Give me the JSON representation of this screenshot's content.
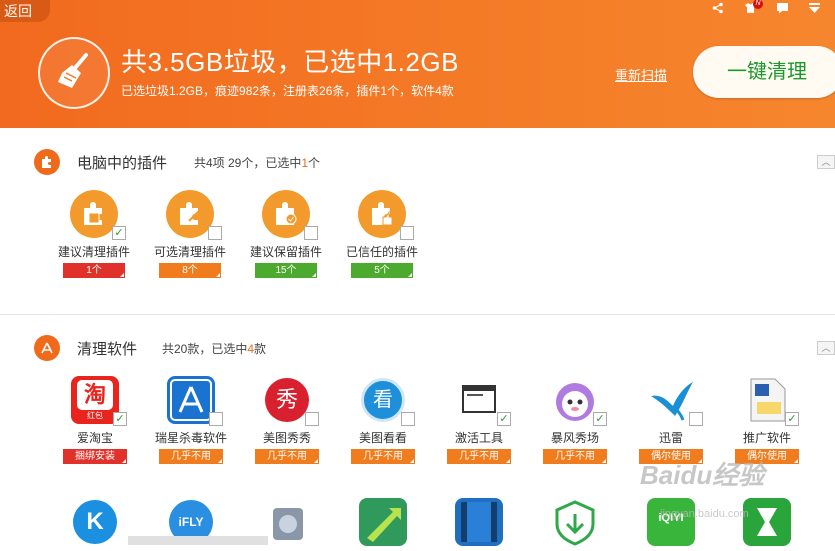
{
  "header": {
    "back": "返回",
    "title": "共3.5GB垃圾，已选中1.2GB",
    "subtitle": "已选垃圾1.2GB，痕迹982条，注册表26条，插件1个，软件4款",
    "rescan": "重新扫描",
    "clean_button": "一键清理",
    "badge": "N"
  },
  "plugins_section": {
    "title": "电脑中的插件",
    "count_prefix": "共4项 29个，已选中",
    "count_highlight": "1",
    "count_suffix": "个",
    "items": [
      {
        "label": "建议清理插件",
        "tag": "1个",
        "checked": true
      },
      {
        "label": "可选清理插件",
        "tag": "8个",
        "checked": false
      },
      {
        "label": "建议保留插件",
        "tag": "15个",
        "checked": false
      },
      {
        "label": "已信任的插件",
        "tag": "5个",
        "checked": false
      }
    ]
  },
  "software_section": {
    "title": "清理软件",
    "count_prefix": "共20款，已选中",
    "count_highlight": "4",
    "count_suffix": "款",
    "apps": [
      {
        "label": "爱淘宝",
        "tag": "捆绑安装",
        "glyph": "淘",
        "sub": "红包",
        "checked": true
      },
      {
        "label": "瑞星杀毒软件",
        "tag": "几乎不用",
        "checked": false
      },
      {
        "label": "美图秀秀",
        "tag": "几乎不用",
        "glyph": "秀",
        "checked": false
      },
      {
        "label": "美图看看",
        "tag": "几乎不用",
        "glyph": "看",
        "checked": false
      },
      {
        "label": "激活工具",
        "tag": "几乎不用",
        "checked": true
      },
      {
        "label": "暴风秀场",
        "tag": "几乎不用",
        "checked": true
      },
      {
        "label": "迅雷",
        "tag": "偶尔使用",
        "checked": false
      },
      {
        "label": "推广软件",
        "tag": "偶尔使用",
        "checked": true
      }
    ],
    "row2": [
      {
        "glyph": "K"
      },
      {
        "glyph": "iFLY"
      },
      {
        "glyph": ""
      },
      {
        "glyph": ""
      },
      {
        "glyph": ""
      },
      {
        "glyph": ""
      },
      {
        "glyph": "iQIYI"
      },
      {
        "glyph": ""
      }
    ]
  },
  "watermark": {
    "logo": "Baidu经验",
    "url": "jingyan.baidu.com"
  },
  "colors": {
    "accent": "#f26a1f",
    "clean_text": "#1a9a2c",
    "tag_red": "#e0322a",
    "tag_orange": "#f07c1d",
    "tag_green": "#4cab2e"
  }
}
